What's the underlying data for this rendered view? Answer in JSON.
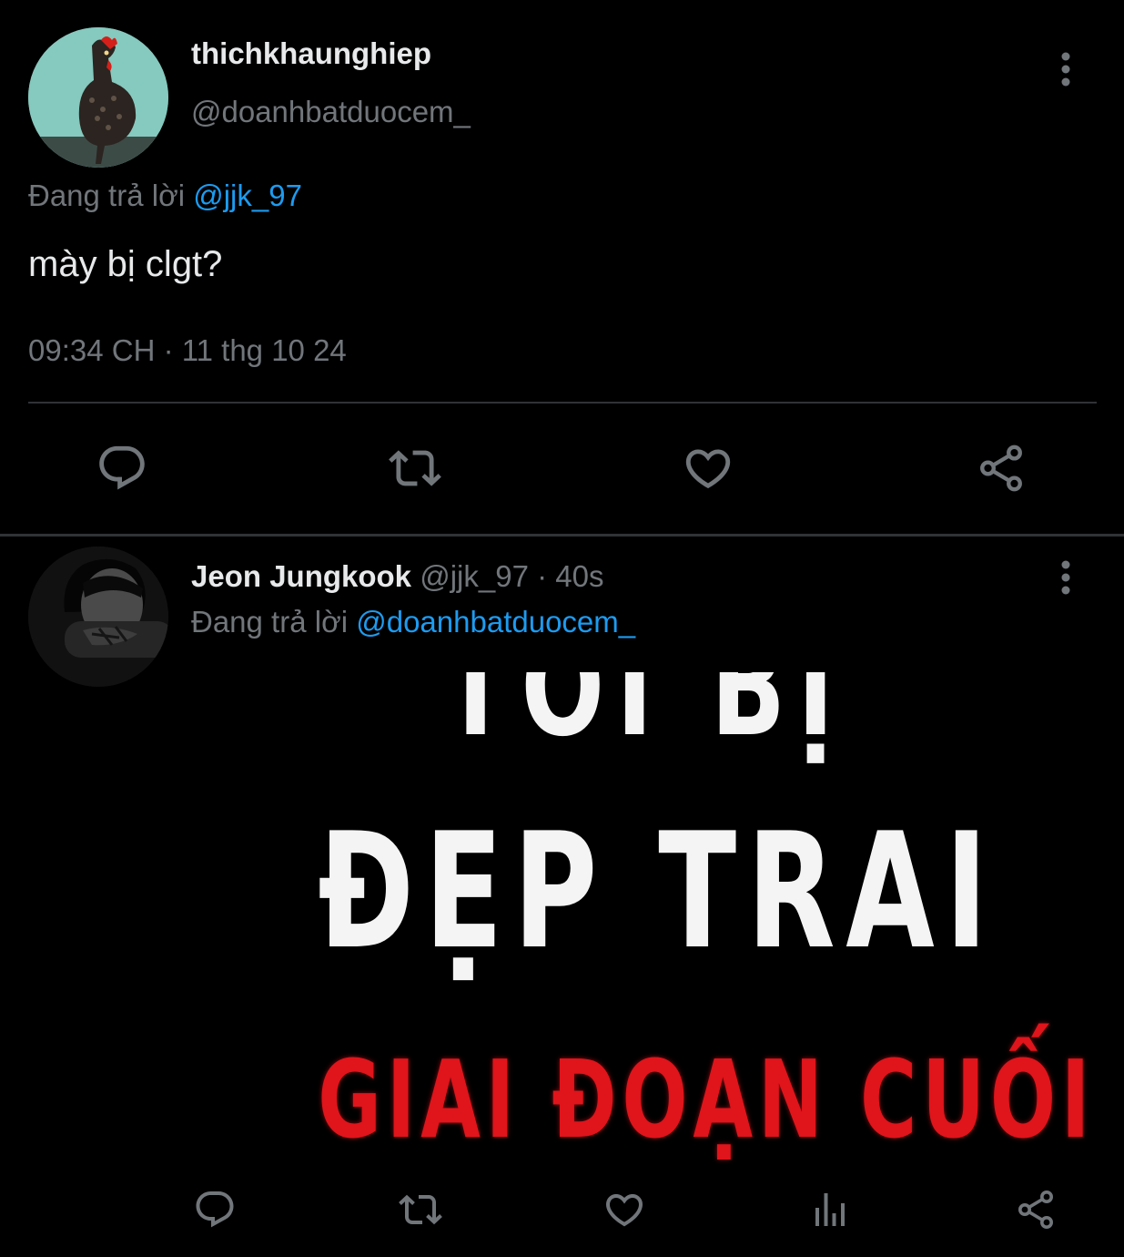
{
  "tweet1": {
    "display_name": "thichkhaunghiep",
    "handle": "@doanhbatduocem_",
    "reply_prefix": "Đang trả lời",
    "reply_to": "@jjk_97",
    "text": "mày bị clgt?",
    "timestamp": "09:34 CH · 11 thg 10 24",
    "actions": [
      "reply-icon",
      "retweet-icon",
      "like-icon",
      "share-icon"
    ]
  },
  "tweet2": {
    "display_name": "Jeon Jungkook",
    "handle": "@jjk_97",
    "separator": "·",
    "age": "40s",
    "reply_prefix": "Đang trả lời",
    "reply_to": "@doanhbatduocem_",
    "image_text": {
      "line1": "TÔI BỊ",
      "line2": "ĐẸP TRAI",
      "line3": "GIAI ĐOẠN CUỐI"
    },
    "actions": [
      "reply-icon",
      "retweet-icon",
      "like-icon",
      "views-icon",
      "share-icon"
    ]
  },
  "colors": {
    "background": "#000000",
    "primary_text": "#e7e9ea",
    "secondary_text": "#71767b",
    "accent": "#1d9bf0",
    "divider": "#2f3336",
    "meme_red": "#e0141b"
  }
}
